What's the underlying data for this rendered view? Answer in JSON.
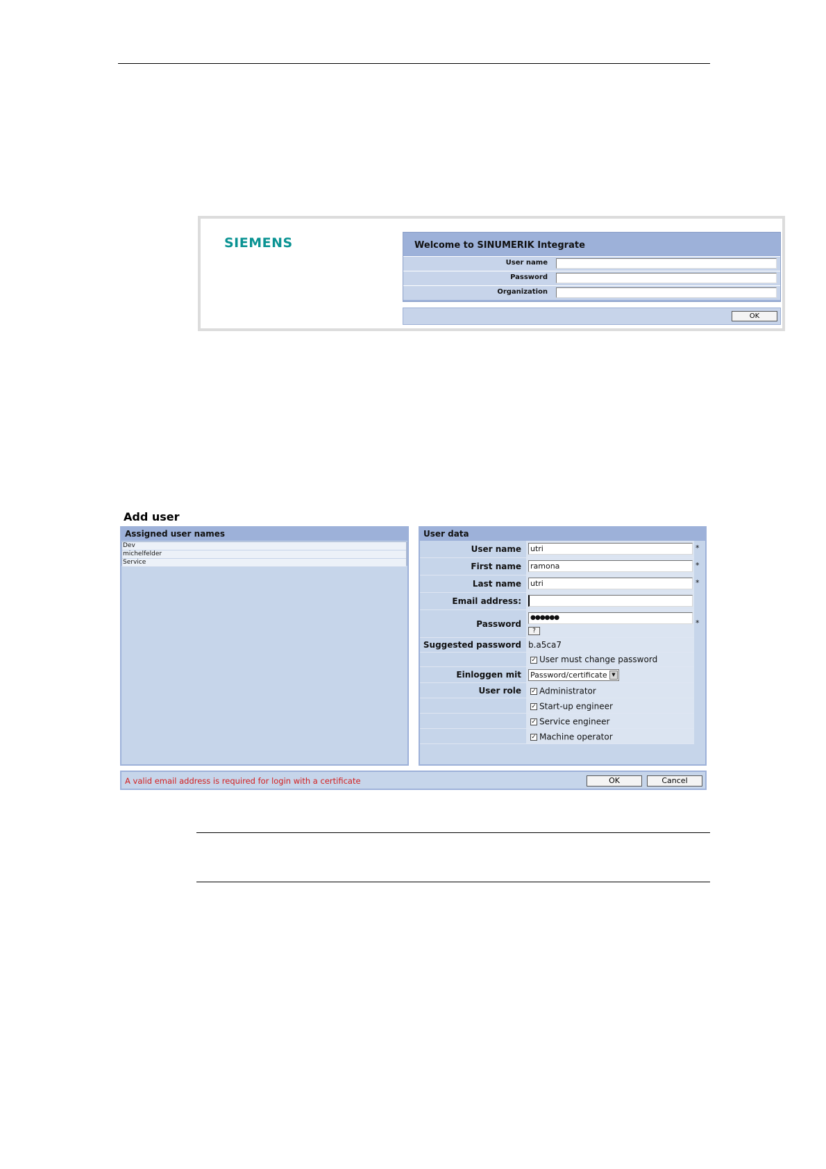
{
  "login": {
    "logo_text": "SIEMENS",
    "title": "Welcome to SINUMERIK Integrate",
    "fields": [
      {
        "label": "User name",
        "value": ""
      },
      {
        "label": "Password",
        "value": ""
      },
      {
        "label": "Organization",
        "value": ""
      }
    ],
    "ok_label": "OK"
  },
  "add_user": {
    "title": "Add user",
    "assigned": {
      "header": "Assigned user names",
      "items": [
        "Dev",
        "michelfelder",
        "Service"
      ]
    },
    "user_data": {
      "header": "User data",
      "user_name_label": "User name",
      "user_name_value": "utri",
      "first_name_label": "First name",
      "first_name_value": "ramona",
      "last_name_label": "Last name",
      "last_name_value": "utri",
      "email_label": "Email address:",
      "email_value": "",
      "password_label": "Password",
      "password_value": "●●●●●●",
      "help_label": "?",
      "suggested_label": "Suggested password",
      "suggested_value": "b.a5ca7",
      "must_change_label": "User must change password",
      "login_with_label": "Einloggen mit",
      "login_with_value": "Password/certificate",
      "role_label": "User role",
      "roles": [
        "Administrator",
        "Start-up engineer",
        "Service engineer",
        "Machine operator"
      ],
      "required_mark": "*",
      "check_mark": "✓"
    },
    "footer": {
      "message": "A valid email address is required for login with a certificate",
      "ok_label": "OK",
      "cancel_label": "Cancel"
    }
  },
  "colors": {
    "panel_header": "#9db1d9",
    "panel_body": "#c6d5ea",
    "logo": "#0a9393",
    "error": "#d32020"
  }
}
